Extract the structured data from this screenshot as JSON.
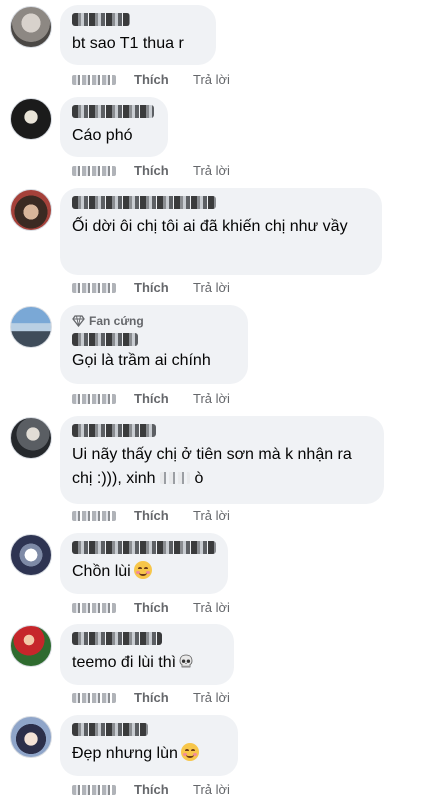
{
  "actions": {
    "like": "Thích",
    "reply": "Trả lời"
  },
  "comments": [
    {
      "text": "bt sao T1 thua r",
      "badge": "",
      "emoji": ""
    },
    {
      "text": "Cáo phó",
      "badge": "",
      "emoji": ""
    },
    {
      "text": "Ối dời ôi chị tôi ai đã khiến chị như vầy",
      "badge": "",
      "emoji": ""
    },
    {
      "text": "Gọi là trầm ai chính",
      "badge": "Fan cứng",
      "emoji": ""
    },
    {
      "text": "Ui nãy thấy chị ở tiên sơn mà k nhận ra chị :))), xinh ",
      "badge": "",
      "emoji": ""
    },
    {
      "text": "Chồn lùi",
      "badge": "",
      "emoji": "smiling-face"
    },
    {
      "text": "teemo đi lùi thì",
      "badge": "",
      "emoji": "skull"
    },
    {
      "text": "Đẹp nhưng lùn",
      "badge": "",
      "emoji": "smiling-face"
    }
  ],
  "colors": {
    "bubble": "#f0f2f5",
    "action_text": "#65676b",
    "body_text": "#050505"
  }
}
